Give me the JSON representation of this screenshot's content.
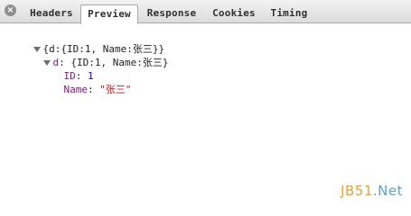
{
  "close_glyph": "×",
  "tabs": [
    {
      "label": "Headers",
      "active": false
    },
    {
      "label": "Preview",
      "active": true
    },
    {
      "label": "Response",
      "active": false
    },
    {
      "label": "Cookies",
      "active": false
    },
    {
      "label": "Timing",
      "active": false
    }
  ],
  "tree": {
    "root": {
      "summary": "{d:{ID:1, Name:张三}}",
      "child": {
        "key": "d",
        "summary": "{ID:1, Name:张三}",
        "props": [
          {
            "key": "ID",
            "value": "1",
            "type": "number"
          },
          {
            "key": "Name",
            "value": "\"张三\"",
            "type": "string"
          }
        ]
      }
    }
  },
  "watermark": {
    "part1": "JB51",
    "part2": ".Net"
  },
  "colors": {
    "key": "#881391",
    "number": "#1c00cf",
    "string": "#c41a16",
    "watermark_a": "#f0a030",
    "watermark_b": "#5aa0d8"
  }
}
